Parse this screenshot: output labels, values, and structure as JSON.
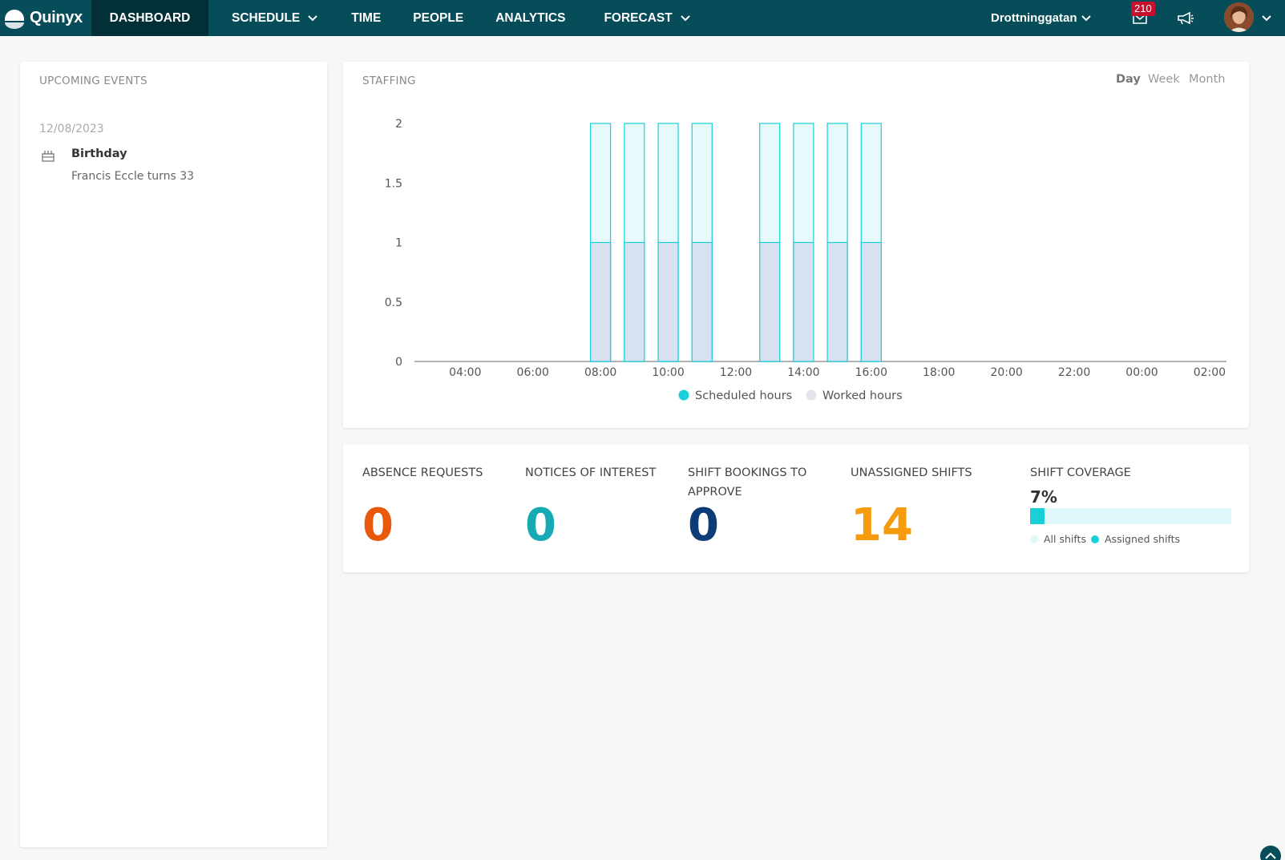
{
  "app": {
    "name": "Quinyx"
  },
  "nav": {
    "dashboard": "DASHBOARD",
    "schedule": "SCHEDULE",
    "time": "TIME",
    "people": "PEOPLE",
    "analytics": "ANALYTICS",
    "forecast": "FORECAST",
    "location": "Drottninggatan",
    "notification_count": "210",
    "icons": [
      "logo-icon",
      "chevron-down-icon",
      "mail-icon",
      "megaphone-icon",
      "avatar"
    ]
  },
  "events": {
    "title": "UPCOMING EVENTS",
    "items": [
      {
        "date": "12/08/2023",
        "icon": "cake-icon",
        "title": "Birthday",
        "subtitle": "Francis Eccle turns 33"
      }
    ]
  },
  "staffing": {
    "title": "STAFFING",
    "periods": [
      "Day",
      "Week",
      "Month"
    ],
    "active_period": "Day"
  },
  "chart_data": {
    "type": "bar",
    "x": [
      "03:00",
      "04:00",
      "05:00",
      "06:00",
      "07:00",
      "08:00",
      "09:00",
      "10:00",
      "11:00",
      "12:00",
      "13:00",
      "14:00",
      "15:00",
      "16:00",
      "17:00",
      "18:00",
      "19:00",
      "20:00",
      "21:00",
      "22:00",
      "23:00",
      "00:00",
      "01:00",
      "02:00"
    ],
    "tick_labels": [
      "04:00",
      "06:00",
      "08:00",
      "10:00",
      "12:00",
      "14:00",
      "16:00",
      "18:00",
      "20:00",
      "22:00",
      "00:00",
      "02:00"
    ],
    "series": [
      {
        "name": "Scheduled hours",
        "color": "#19cfd8",
        "values": [
          0,
          0,
          0,
          0,
          0,
          2,
          2,
          2,
          2,
          0,
          2,
          2,
          2,
          2,
          0,
          0,
          0,
          0,
          0,
          0,
          0,
          0,
          0,
          0
        ]
      },
      {
        "name": "Worked hours",
        "color": "#e4e4ee",
        "values": [
          0,
          0,
          0,
          0,
          0,
          1,
          1,
          1,
          1,
          0,
          1,
          1,
          1,
          1,
          0,
          0,
          0,
          0,
          0,
          0,
          0,
          0,
          0,
          0
        ]
      }
    ],
    "yticks": [
      "0",
      "0.5",
      "1",
      "1.5",
      "2"
    ],
    "ylim": [
      0,
      2
    ],
    "legend": "bottom-center"
  },
  "stats": {
    "absence": {
      "label": "ABSENCE REQUESTS",
      "value": "0",
      "color": "#e8590c"
    },
    "notices": {
      "label": "NOTICES OF INTEREST",
      "value": "0",
      "color": "#16aab4"
    },
    "bookings": {
      "label_line1": "SHIFT BOOKINGS TO",
      "label_line2": "APPROVE",
      "value": "0",
      "color": "#0b3c78"
    },
    "unassigned": {
      "label": "UNASSIGNED SHIFTS",
      "value": "14",
      "color": "#f59b0c"
    },
    "coverage": {
      "label": "SHIFT COVERAGE",
      "value_text": "7%",
      "value": 0.07,
      "legend_all": "All shifts",
      "legend_assigned": "Assigned shifts"
    }
  }
}
